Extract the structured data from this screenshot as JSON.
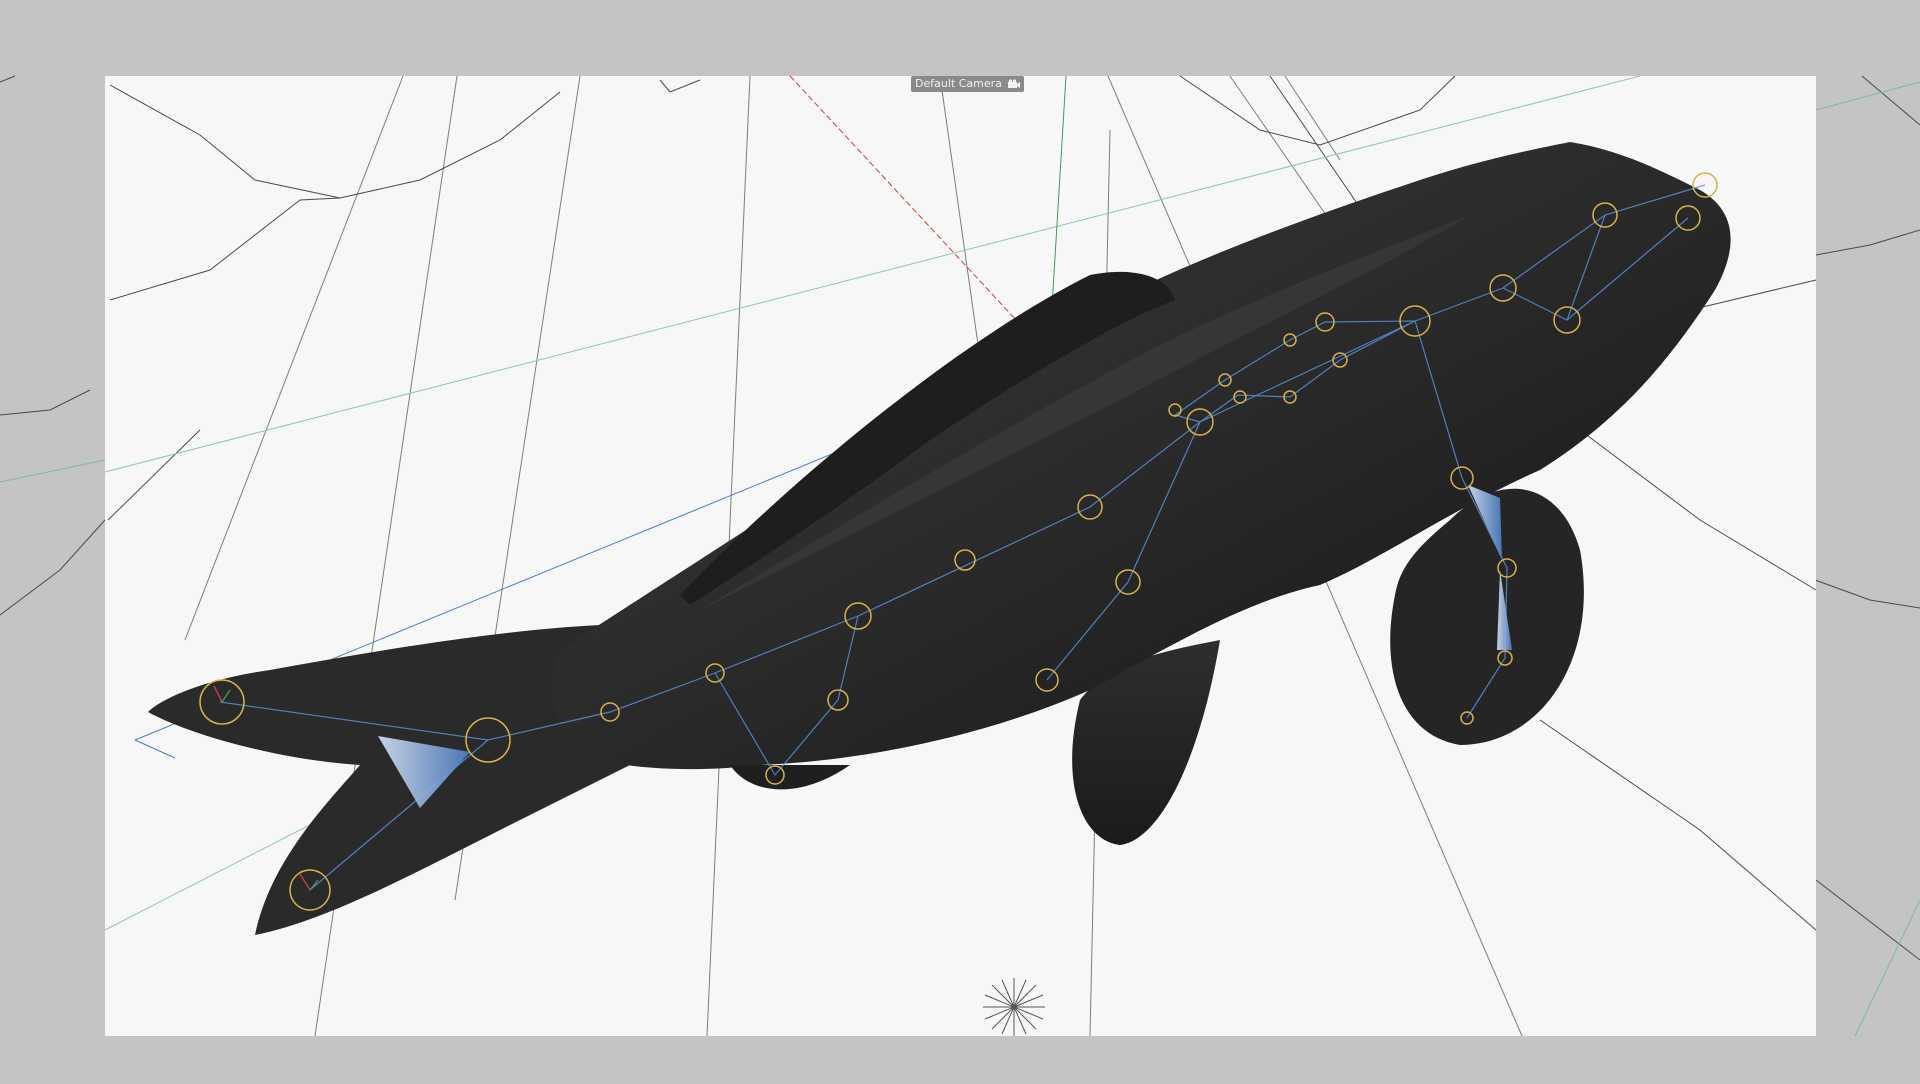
{
  "viewport": {
    "camera_label": "Default Camera",
    "camera_icon": "camera-icon",
    "background_color": "#c4c4c4",
    "safe_frame_color": "#f7f7f7",
    "model_color": "#2a2a2a",
    "joint_color": "#d9b24a",
    "bone_color": "#5a8fd6"
  }
}
